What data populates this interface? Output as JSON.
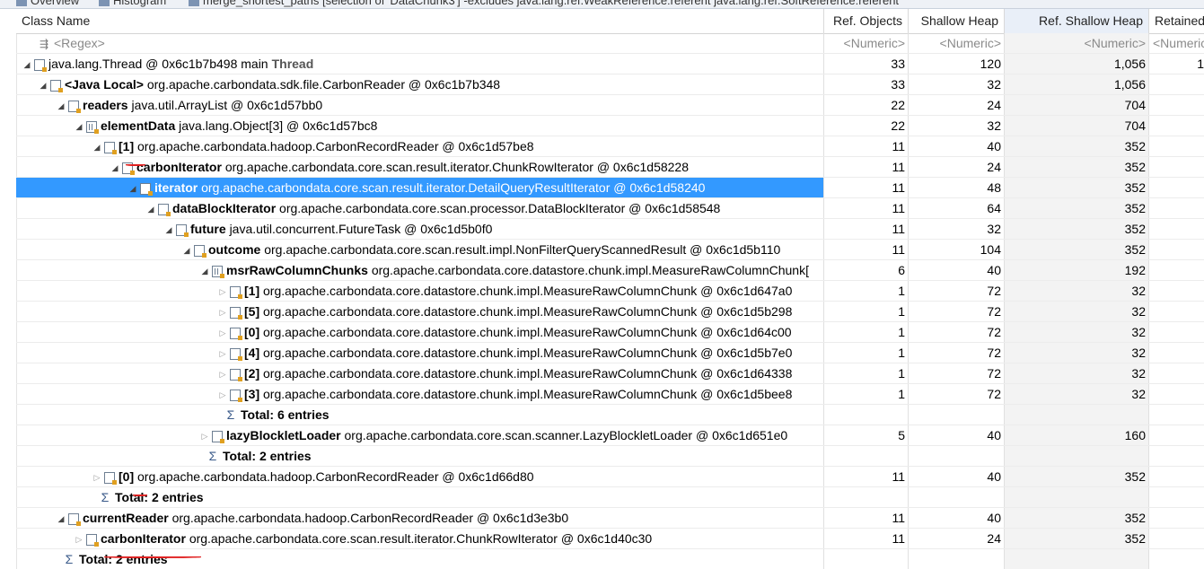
{
  "tabs": [
    {
      "label": "Overview"
    },
    {
      "label": "Histogram"
    },
    {
      "label": "merge_shortest_paths [selection of 'DataChunk3'] -excludes java.lang.ref.WeakReference:referent java.lang.ref.SoftReference:referent"
    }
  ],
  "columns": {
    "name": "Class Name",
    "ref_objects": "Ref. Objects",
    "shallow_heap": "Shallow Heap",
    "ref_shallow_heap": "Ref. Shallow Heap",
    "retained": "Retained"
  },
  "filter": {
    "name": "<Regex>",
    "numeric": "<Numeric>"
  },
  "rows": [
    {
      "kw": "",
      "label": "java.lang.Thread @ 0x6c1b7b498  main",
      "suffix": "Thread",
      "a": "33",
      "b": "120",
      "c": "1,056",
      "d": "1"
    },
    {
      "kw": "<Java Local>",
      "label": "org.apache.carbondata.sdk.file.CarbonReader @ 0x6c1b7b348",
      "a": "33",
      "b": "32",
      "c": "1,056",
      "d": ""
    },
    {
      "kw": "readers",
      "label": "java.util.ArrayList @ 0x6c1d57bb0",
      "a": "22",
      "b": "24",
      "c": "704",
      "d": ""
    },
    {
      "kw": "elementData",
      "label": "java.lang.Object[3] @ 0x6c1d57bc8",
      "a": "22",
      "b": "32",
      "c": "704",
      "d": ""
    },
    {
      "kw": "[1]",
      "label": "org.apache.carbondata.hadoop.CarbonRecordReader @ 0x6c1d57be8",
      "a": "11",
      "b": "40",
      "c": "352",
      "d": ""
    },
    {
      "kw": "carbonIterator",
      "label": "org.apache.carbondata.core.scan.result.iterator.ChunkRowIterator @ 0x6c1d58228",
      "a": "11",
      "b": "24",
      "c": "352",
      "d": ""
    },
    {
      "kw": "iterator",
      "label": "org.apache.carbondata.core.scan.result.iterator.DetailQueryResultIterator @ 0x6c1d58240",
      "a": "11",
      "b": "48",
      "c": "352",
      "d": ""
    },
    {
      "kw": "dataBlockIterator",
      "label": "org.apache.carbondata.core.scan.processor.DataBlockIterator @ 0x6c1d58548",
      "a": "11",
      "b": "64",
      "c": "352",
      "d": ""
    },
    {
      "kw": "future",
      "label": "java.util.concurrent.FutureTask @ 0x6c1d5b0f0",
      "a": "11",
      "b": "32",
      "c": "352",
      "d": ""
    },
    {
      "kw": "outcome",
      "label": "org.apache.carbondata.core.scan.result.impl.NonFilterQueryScannedResult @ 0x6c1d5b110",
      "a": "11",
      "b": "104",
      "c": "352",
      "d": ""
    },
    {
      "kw": "msrRawColumnChunks",
      "label": "org.apache.carbondata.core.datastore.chunk.impl.MeasureRawColumnChunk[",
      "a": "6",
      "b": "40",
      "c": "192",
      "d": ""
    },
    {
      "kw": "[1]",
      "label": "org.apache.carbondata.core.datastore.chunk.impl.MeasureRawColumnChunk @ 0x6c1d647a0",
      "a": "1",
      "b": "72",
      "c": "32",
      "d": ""
    },
    {
      "kw": "[5]",
      "label": "org.apache.carbondata.core.datastore.chunk.impl.MeasureRawColumnChunk @ 0x6c1d5b298",
      "a": "1",
      "b": "72",
      "c": "32",
      "d": ""
    },
    {
      "kw": "[0]",
      "label": "org.apache.carbondata.core.datastore.chunk.impl.MeasureRawColumnChunk @ 0x6c1d64c00",
      "a": "1",
      "b": "72",
      "c": "32",
      "d": ""
    },
    {
      "kw": "[4]",
      "label": "org.apache.carbondata.core.datastore.chunk.impl.MeasureRawColumnChunk @ 0x6c1d5b7e0",
      "a": "1",
      "b": "72",
      "c": "32",
      "d": ""
    },
    {
      "kw": "[2]",
      "label": "org.apache.carbondata.core.datastore.chunk.impl.MeasureRawColumnChunk @ 0x6c1d64338",
      "a": "1",
      "b": "72",
      "c": "32",
      "d": ""
    },
    {
      "kw": "[3]",
      "label": "org.apache.carbondata.core.datastore.chunk.impl.MeasureRawColumnChunk @ 0x6c1d5bee8",
      "a": "1",
      "b": "72",
      "c": "32",
      "d": ""
    },
    {
      "kw": "Total: 6 entries",
      "label": "",
      "a": "",
      "b": "",
      "c": "",
      "d": ""
    },
    {
      "kw": "lazyBlockletLoader",
      "label": "org.apache.carbondata.core.scan.scanner.LazyBlockletLoader @ 0x6c1d651e0",
      "a": "5",
      "b": "40",
      "c": "160",
      "d": ""
    },
    {
      "kw": "Total: 2 entries",
      "label": "",
      "a": "",
      "b": "",
      "c": "",
      "d": ""
    },
    {
      "kw": "[0]",
      "label": "org.apache.carbondata.hadoop.CarbonRecordReader @ 0x6c1d66d80",
      "a": "11",
      "b": "40",
      "c": "352",
      "d": ""
    },
    {
      "kw": "Total: 2 entries",
      "label": "",
      "a": "",
      "b": "",
      "c": "",
      "d": ""
    },
    {
      "kw": "currentReader",
      "label": "org.apache.carbondata.hadoop.CarbonRecordReader @ 0x6c1d3e3b0",
      "a": "11",
      "b": "40",
      "c": "352",
      "d": ""
    },
    {
      "kw": "carbonIterator",
      "label": "org.apache.carbondata.core.scan.result.iterator.ChunkRowIterator @ 0x6c1d40c30",
      "a": "11",
      "b": "24",
      "c": "352",
      "d": ""
    },
    {
      "kw": "Total: 2 entries",
      "label": "",
      "a": "",
      "b": "",
      "c": "",
      "d": ""
    }
  ]
}
